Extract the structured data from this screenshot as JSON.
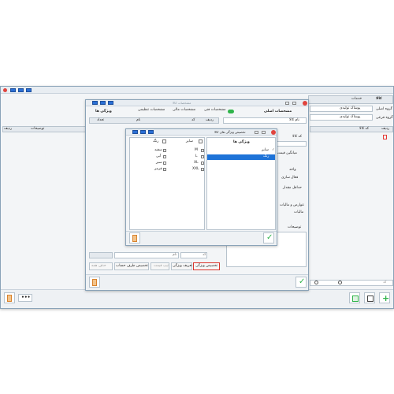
{
  "main_window": {
    "tab_right": "کالا",
    "tab_center": "خدمات",
    "left_header": "توضیحات",
    "left_header2": "ردیف",
    "group_main_label": "گروه اصلی",
    "group_main_value": "پوشاک تولیدی",
    "group_sub_label": "گروه فرعی",
    "group_sub_value": "پوشاک تولیدی",
    "code_header": "کد کالا",
    "row_header": "ردیف",
    "search_placeholder": "کد"
  },
  "mid_window": {
    "title": "مشخصات کالا",
    "tabs": [
      "مشخصات اصلی",
      "مشخصات فنی",
      "مشخصات مالی",
      "مشخصات تنظیمی",
      "ویژگی ها"
    ],
    "table_headers": [
      "ردیف",
      "کد",
      "نام",
      "تعداد"
    ],
    "fields": [
      "نام کالا",
      "کد کالا",
      "میانگین قیمت خرید",
      "واحد",
      "فعال سازی",
      "حداقل مقدار",
      "عوارض و مالیات",
      "مالیات",
      "توضیحات"
    ],
    "bottom_buttons": [
      "تخصیص ویژگی",
      "تعریف ویژگی",
      "تیپ قیمت",
      "تخصیص طرف حساب",
      "حذف همه"
    ],
    "name_label": "نام",
    "code_label": "کد"
  },
  "dialog": {
    "title": "تخصیص ویژگی های کالا",
    "list_header": "ویژگی ها",
    "list_items": [
      "سایز",
      "رنگ"
    ],
    "selected_item": "رنگ",
    "group_size": "سایز",
    "group_color": "رنگ",
    "sizes": [
      "M",
      "L",
      "XL",
      "XXL"
    ],
    "colors": [
      "سفید",
      "آبی",
      "سبز",
      "قرمز"
    ]
  },
  "colors": {
    "accent": "#1e73d8",
    "green": "#2fb44a",
    "red": "#e53935",
    "highlight_border": "#d9342b"
  }
}
